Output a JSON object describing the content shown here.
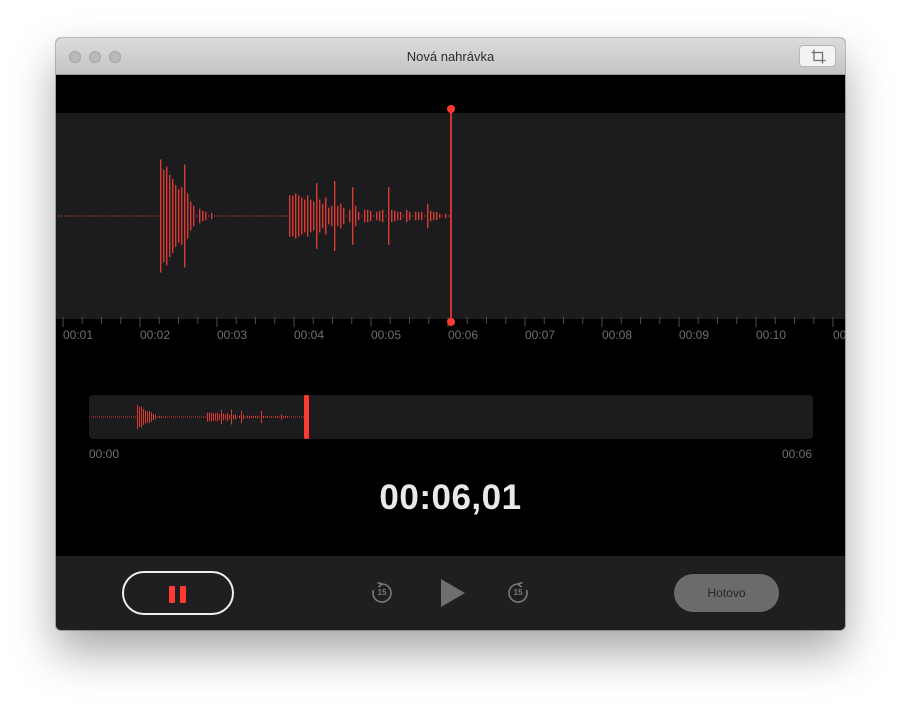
{
  "window": {
    "title": "Nová nahrávka",
    "traffic_lights": [
      "close",
      "minimize",
      "zoom"
    ],
    "toolbar_icon": "crop-icon"
  },
  "timeline": {
    "tick_labels": [
      "00:01",
      "00:02",
      "00:03",
      "00:04",
      "00:05",
      "00:06",
      "00:07",
      "00:08",
      "00:09",
      "00:10",
      "00:"
    ],
    "playhead_time": "00:06"
  },
  "overview": {
    "start_label": "00:00",
    "end_label": "00:06"
  },
  "timer": {
    "value": "00:06,01"
  },
  "controls": {
    "pause_icon": "pause-icon",
    "skip_back_icon": "skip-back-15-icon",
    "skip_back_label": "15",
    "play_icon": "play-icon",
    "skip_forward_icon": "skip-forward-15-icon",
    "skip_forward_label": "15",
    "done_label": "Hotovo"
  },
  "colors": {
    "accent": "#ff3b30",
    "waveform": "#d93a32",
    "background": "#000000",
    "panel": "#1c1c1f",
    "tick_text": "#6f6f72"
  }
}
